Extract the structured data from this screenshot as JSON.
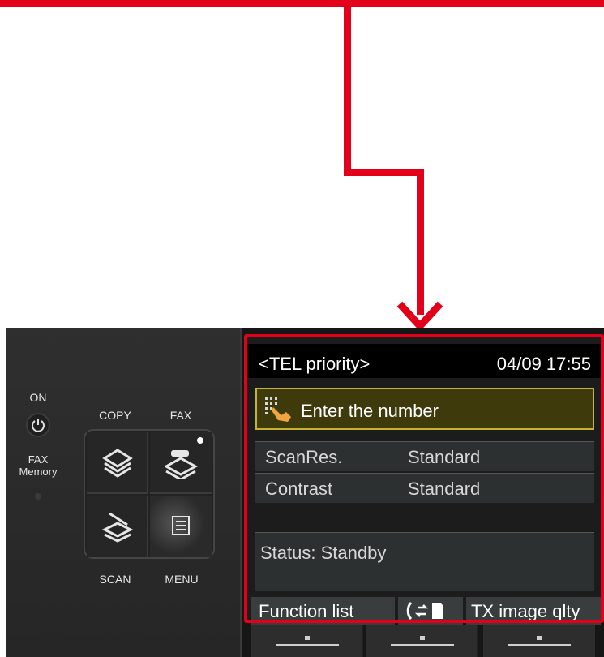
{
  "colors": {
    "callout": "#e3001b",
    "lcd_background": "#1c1c1c",
    "highlight_border": "#c6b52c",
    "highlight_fill": "#3f3a0b"
  },
  "panel": {
    "on_label": "ON",
    "fax_memory_label": "FAX\nMemory",
    "copy_label": "COPY",
    "fax_label": "FAX",
    "scan_label": "SCAN",
    "menu_label": "MENU",
    "icons": [
      "power-icon",
      "copy-icon",
      "fax-icon",
      "scan-icon",
      "menu-icon"
    ]
  },
  "lcd": {
    "title": "<TEL priority>",
    "datetime": "04/09 17:55",
    "entry_text": "Enter the number",
    "settings": [
      {
        "name": "ScanRes.",
        "value": "Standard"
      },
      {
        "name": "Contrast",
        "value": "Standard"
      }
    ],
    "status": "Status: Standby",
    "function_buttons": [
      {
        "label": "Function list"
      },
      {
        "label": ""
      },
      {
        "label": "TX image qlty"
      }
    ]
  }
}
